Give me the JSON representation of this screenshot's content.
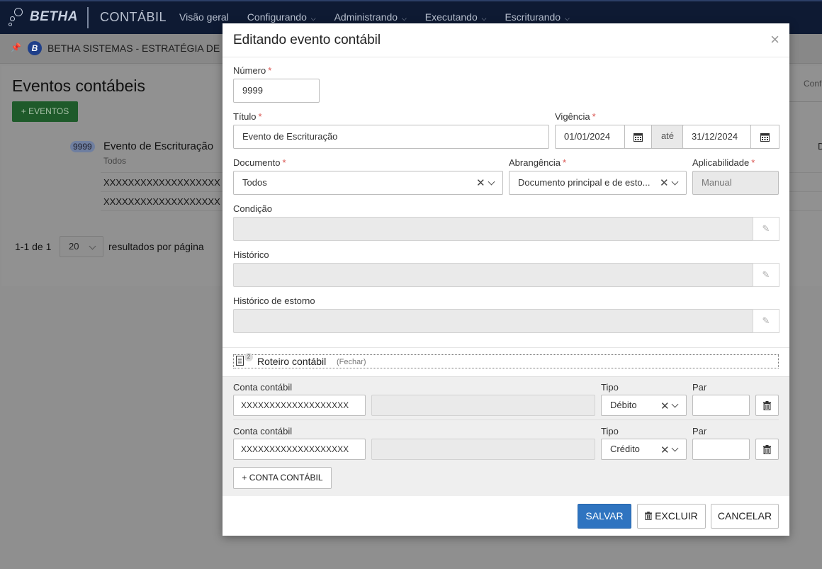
{
  "topbar": {
    "brand": "BETHA",
    "app": "CONTÁBIL",
    "nav": [
      "Visão geral",
      "Configurando",
      "Administrando",
      "Executando",
      "Escriturando"
    ]
  },
  "subbar": {
    "entity_initial": "B",
    "entity_name": "BETHA SISTEMAS - ESTRATÉGIA DE PR"
  },
  "page": {
    "title": "Eventos contábeis",
    "add_button": "+ EVENTOS",
    "right_tab": "Conf",
    "right_letter": "D",
    "event": {
      "number": "9999",
      "title": "Evento de Escrituração",
      "subtitle": "Todos",
      "accounts": [
        "XXXXXXXXXXXXXXXXXXX",
        "XXXXXXXXXXXXXXXXXXX"
      ]
    },
    "pager": {
      "range": "1-1 de 1",
      "page_size": "20",
      "suffix": "resultados por página"
    }
  },
  "modal": {
    "title": "Editando evento contábil",
    "close_icon": "×",
    "fields": {
      "numero": {
        "label": "Número",
        "value": "9999"
      },
      "titulo": {
        "label": "Título",
        "value": "Evento de Escrituração"
      },
      "vigencia": {
        "label": "Vigência",
        "start": "01/01/2024",
        "separator": "até",
        "end": "31/12/2024"
      },
      "documento": {
        "label": "Documento",
        "value": "Todos"
      },
      "abrangencia": {
        "label": "Abrangência",
        "value": "Documento principal e de esto..."
      },
      "aplicabilidade": {
        "label": "Aplicabilidade",
        "value": "Manual"
      },
      "condicao": {
        "label": "Condição",
        "value": ""
      },
      "historico": {
        "label": "Histórico",
        "value": ""
      },
      "historico_estorno": {
        "label": "Histórico de estorno",
        "value": ""
      }
    },
    "required_mark": "*",
    "roteiro": {
      "count": "2",
      "label": "Roteiro contábil",
      "toggle": "(Fechar)",
      "column_labels": {
        "conta": "Conta contábil",
        "tipo": "Tipo",
        "par": "Par"
      },
      "rows": [
        {
          "conta": "XXXXXXXXXXXXXXXXXXX",
          "descricao": "",
          "tipo": "Débito",
          "par": ""
        },
        {
          "conta": "XXXXXXXXXXXXXXXXXXX",
          "descricao": "",
          "tipo": "Crédito",
          "par": ""
        }
      ],
      "add_button": "+ CONTA CONTÁBIL"
    },
    "footer": {
      "save": "SALVAR",
      "delete": "EXCLUIR",
      "cancel": "CANCELAR"
    }
  }
}
